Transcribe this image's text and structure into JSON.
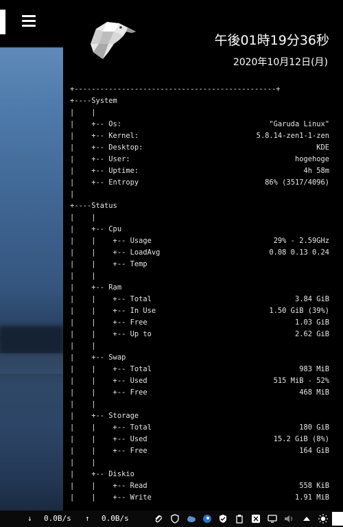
{
  "clock": {
    "time": "午後01時19分36秒",
    "date": "2020年10月12日(月)"
  },
  "tree": {
    "top_border": "+-----------------------------------------------+",
    "rows": [
      {
        "label": "+----System",
        "value": ""
      },
      {
        "label": "|    |",
        "value": ""
      },
      {
        "label": "|    +-- Os:",
        "value": "\"Garuda Linux\""
      },
      {
        "label": "|    +-- Kernel:",
        "value": "5.8.14-zen1-1-zen"
      },
      {
        "label": "|    +-- Desktop:",
        "value": "KDE"
      },
      {
        "label": "|    +-- User:",
        "value": "hogehoge"
      },
      {
        "label": "|    +-- Uptime:",
        "value": "4h 58m"
      },
      {
        "label": "|    +-- Entropy",
        "value": "86% (3517/4096)"
      },
      {
        "label": "|",
        "value": ""
      },
      {
        "label": "+----Status",
        "value": ""
      },
      {
        "label": "|    |",
        "value": ""
      },
      {
        "label": "|    +-- Cpu",
        "value": ""
      },
      {
        "label": "|    |    +-- Usage",
        "value": "29% - 2.59GHz"
      },
      {
        "label": "|    |    +-- LoadAvg",
        "value": "0.08 0.13 0.24"
      },
      {
        "label": "|    |    +-- Temp",
        "value": ""
      },
      {
        "label": "|    |",
        "value": ""
      },
      {
        "label": "|    +-- Ram",
        "value": ""
      },
      {
        "label": "|    |    +-- Total",
        "value": "3.84 GiB"
      },
      {
        "label": "|    |    +-- In Use",
        "value": "1.50 GiB (39%)"
      },
      {
        "label": "|    |    +-- Free",
        "value": "1.03 GiB"
      },
      {
        "label": "|    |    +-- Up to",
        "value": "2.62 GiB"
      },
      {
        "label": "|    |",
        "value": ""
      },
      {
        "label": "|    +-- Swap",
        "value": ""
      },
      {
        "label": "|    |    +-- Total",
        "value": "983 MiB"
      },
      {
        "label": "|    |    +-- Used",
        "value": "515 MiB - 52%"
      },
      {
        "label": "|    |    +-- Free",
        "value": "468 MiB"
      },
      {
        "label": "|    |",
        "value": ""
      },
      {
        "label": "|    +-- Storage",
        "value": ""
      },
      {
        "label": "|    |    +-- Total",
        "value": "180 GiB"
      },
      {
        "label": "|    |    +-- Used",
        "value": "15.2 GiB (8%)"
      },
      {
        "label": "|    |    +-- Free",
        "value": "164 GiB"
      },
      {
        "label": "|    |",
        "value": ""
      },
      {
        "label": "|    +-- Diskio",
        "value": ""
      },
      {
        "label": "|    |    +-- Read",
        "value": "558 KiB"
      },
      {
        "label": "|    |    +-- Write",
        "value": "1.91 MiB"
      }
    ]
  },
  "taskbar": {
    "download_arrow": "↓",
    "download_rate": "0.0B/s",
    "upload_arrow": "↑",
    "upload_rate": "0.0B/s",
    "tray": [
      "paperclip-icon",
      "shield-icon",
      "cloud-icon",
      "steam-icon",
      "shield-check-icon",
      "clipboard-icon",
      "network-icon",
      "monitor-icon",
      "volume-icon",
      "chevron-up-icon",
      "brightness-icon"
    ]
  }
}
